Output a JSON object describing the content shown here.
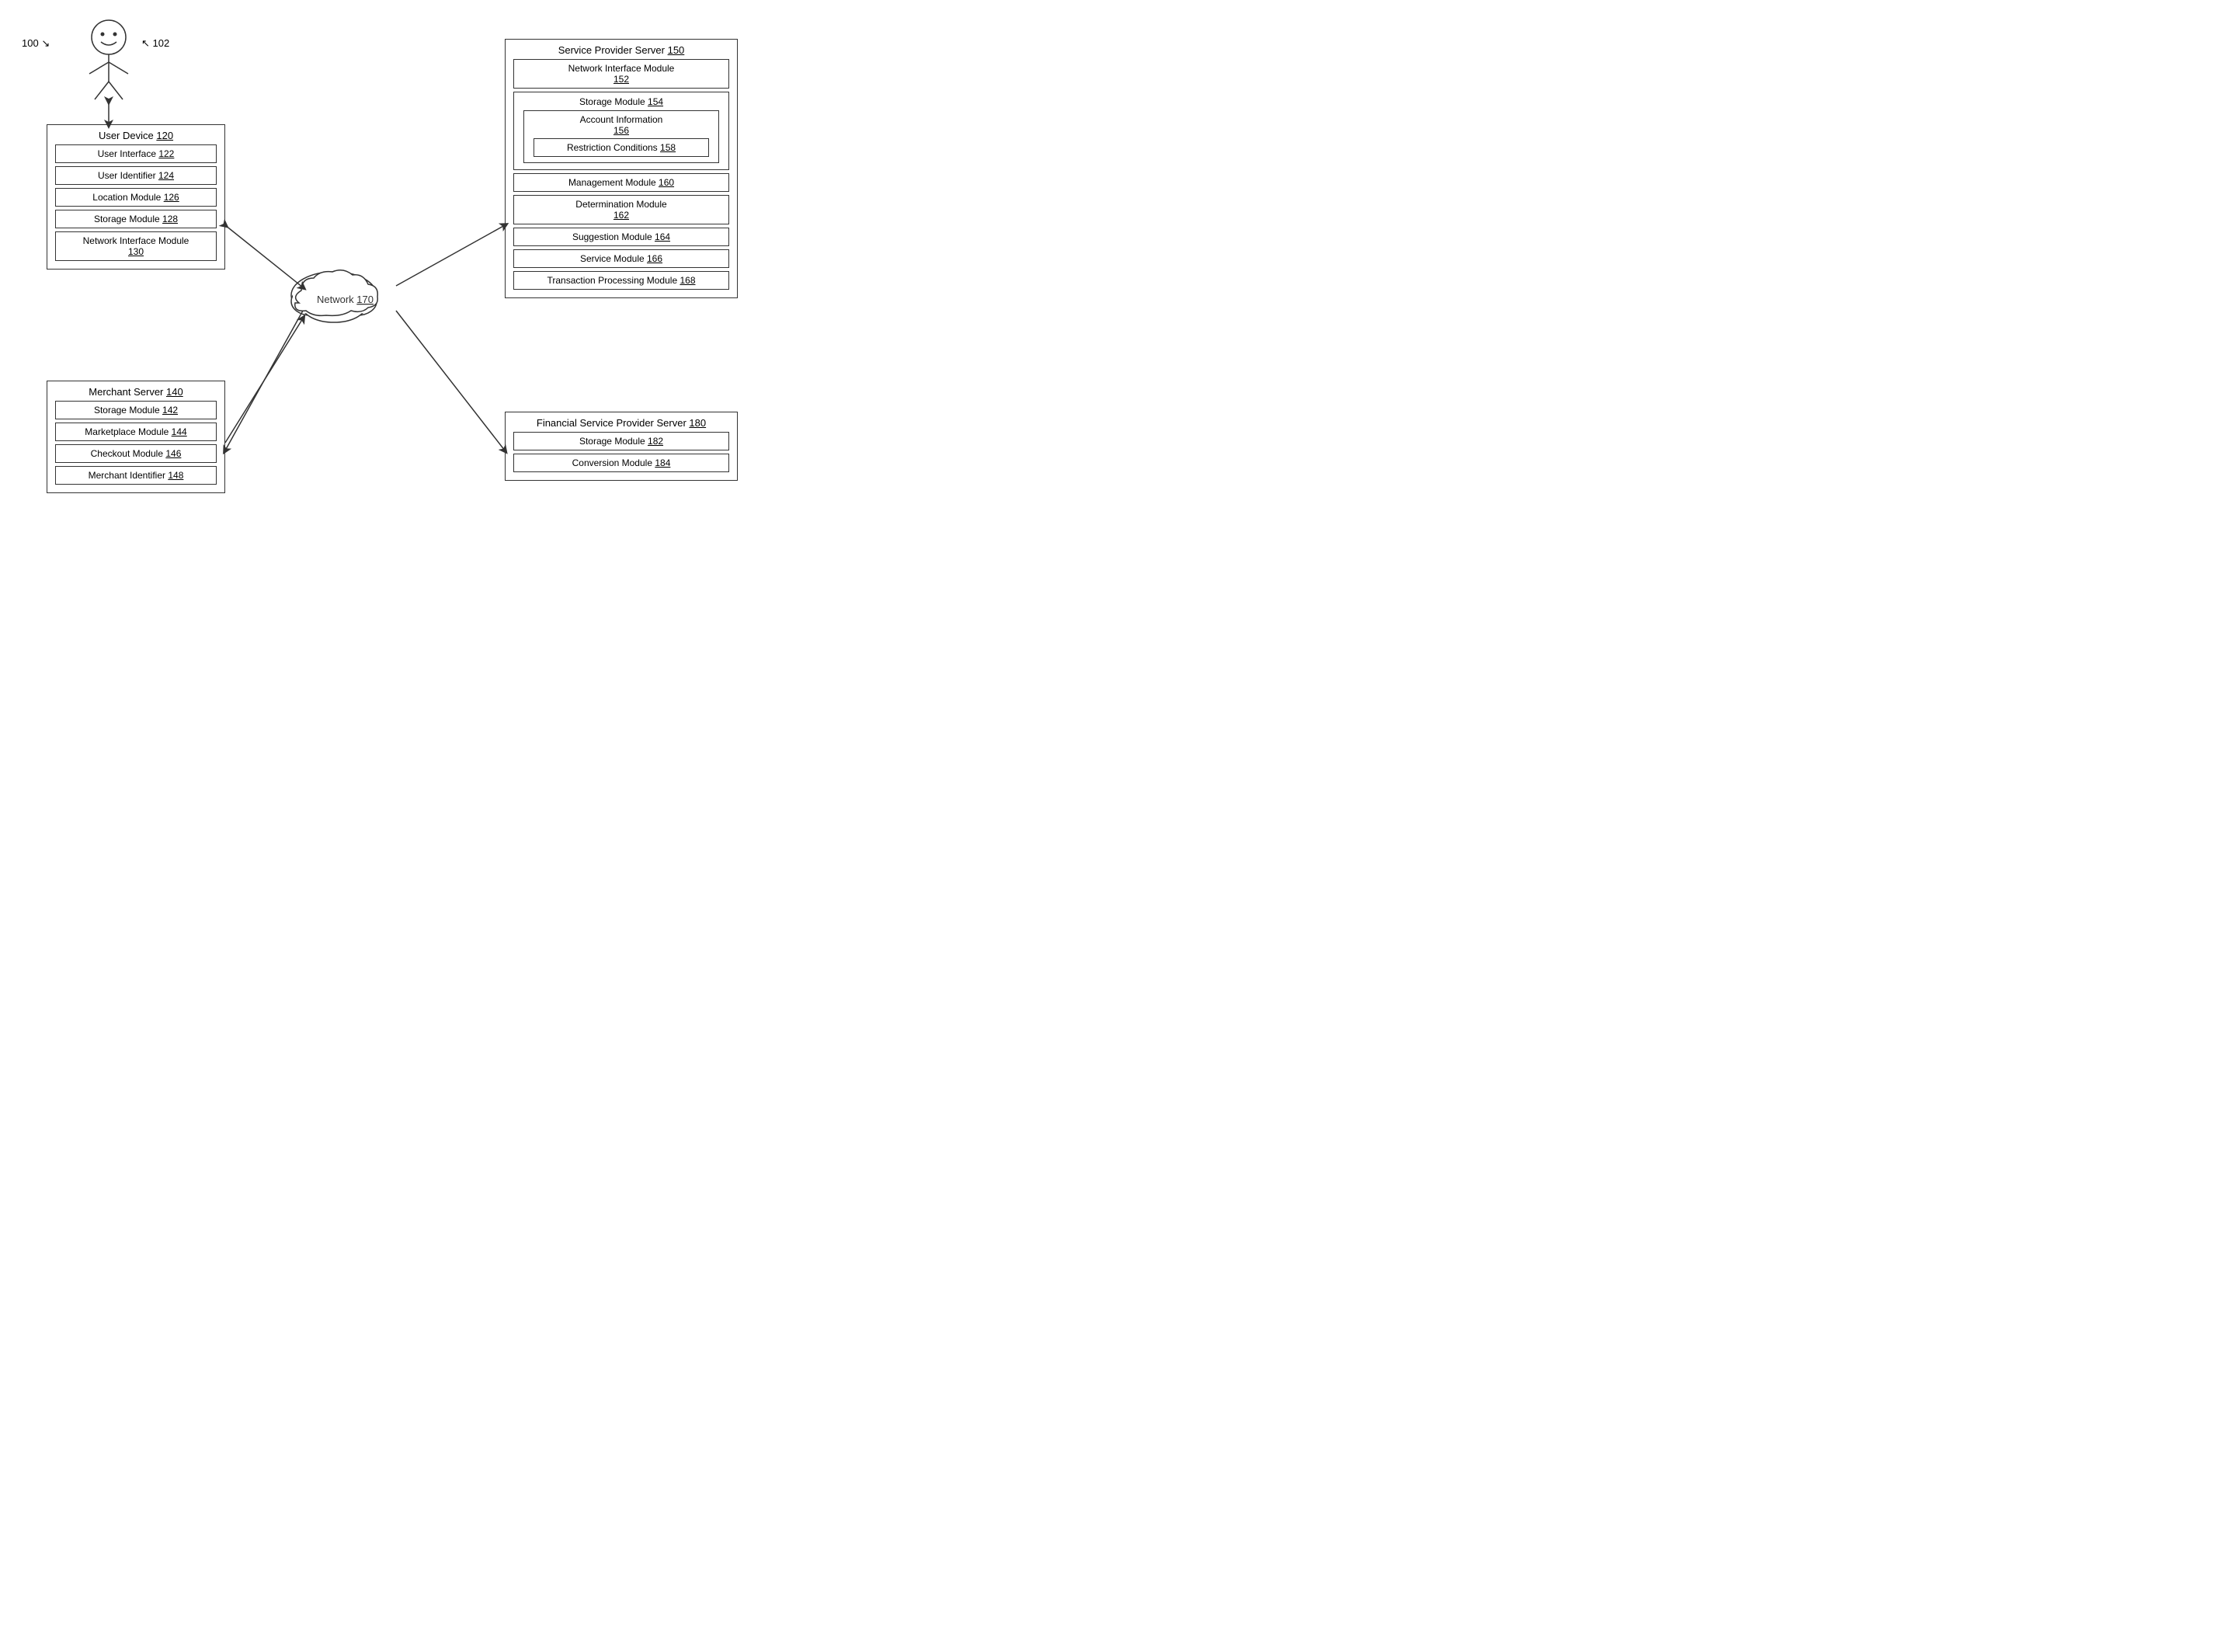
{
  "diagram": {
    "label100": "100",
    "label102": "102",
    "userDevice": {
      "title": "User Device",
      "titleNum": "120",
      "modules": [
        {
          "label": "User Interface",
          "num": "122"
        },
        {
          "label": "User Identifier",
          "num": "124"
        },
        {
          "label": "Location Module",
          "num": "126"
        },
        {
          "label": "Storage Module",
          "num": "128"
        },
        {
          "label": "Network Interface Module",
          "num": "130"
        }
      ]
    },
    "merchantServer": {
      "title": "Merchant Server",
      "titleNum": "140",
      "modules": [
        {
          "label": "Storage Module",
          "num": "142"
        },
        {
          "label": "Marketplace Module",
          "num": "144"
        },
        {
          "label": "Checkout Module",
          "num": "146"
        },
        {
          "label": "Merchant Identifier",
          "num": "148"
        }
      ]
    },
    "serviceProviderServer": {
      "title": "Service Provider Server",
      "titleNum": "150",
      "modules": [
        {
          "label": "Network Interface Module",
          "num": "152"
        },
        {
          "label": "Storage Module",
          "num": "154",
          "nested": [
            {
              "label": "Account Information",
              "num": "156",
              "nested": [
                {
                  "label": "Restriction Conditions",
                  "num": "158"
                }
              ]
            }
          ]
        },
        {
          "label": "Management Module",
          "num": "160"
        },
        {
          "label": "Determination Module",
          "num": "162"
        },
        {
          "label": "Suggestion Module",
          "num": "164"
        },
        {
          "label": "Service Module",
          "num": "166"
        },
        {
          "label": "Transaction Processing Module",
          "num": "168"
        }
      ]
    },
    "financialServiceProvider": {
      "title": "Financial Service Provider Server",
      "titleNum": "180",
      "modules": [
        {
          "label": "Storage Module",
          "num": "182"
        },
        {
          "label": "Conversion Module",
          "num": "184"
        }
      ]
    },
    "network": {
      "label": "Network",
      "num": "170"
    }
  }
}
